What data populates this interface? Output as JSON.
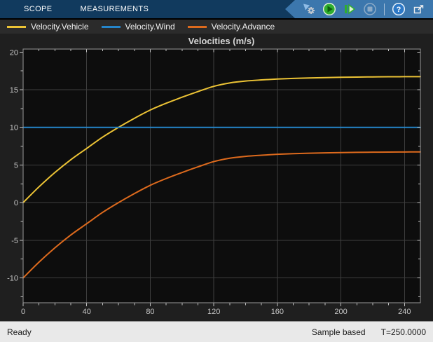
{
  "toolbar": {
    "tabs": [
      {
        "label": "SCOPE"
      },
      {
        "label": "MEASUREMENTS"
      }
    ],
    "icons": [
      "simulation-settings",
      "run",
      "step-forward",
      "stop",
      "help",
      "dock-window"
    ]
  },
  "chart_data": {
    "type": "line",
    "title": "Velocities (m/s)",
    "x": [
      0,
      10,
      20,
      30,
      40,
      50,
      60,
      70,
      80,
      90,
      100,
      110,
      120,
      130,
      140,
      150,
      160,
      170,
      180,
      190,
      200,
      210,
      220,
      230,
      240,
      250
    ],
    "series": [
      {
        "name": "Velocity.Vehicle",
        "color": "#ECC335",
        "values": [
          0.0,
          2.1,
          4.0,
          5.7,
          7.2,
          8.7,
          10.0,
          11.2,
          12.3,
          13.2,
          14.0,
          14.75,
          15.45,
          15.9,
          16.15,
          16.3,
          16.42,
          16.5,
          16.56,
          16.61,
          16.65,
          16.68,
          16.7,
          16.72,
          16.73,
          16.74
        ]
      },
      {
        "name": "Velocity.Wind",
        "color": "#2585CA",
        "values": [
          10,
          10,
          10,
          10,
          10,
          10,
          10,
          10,
          10,
          10,
          10,
          10,
          10,
          10,
          10,
          10,
          10,
          10,
          10,
          10,
          10,
          10,
          10,
          10,
          10,
          10
        ]
      },
      {
        "name": "Velocity.Advance",
        "color": "#DD6A1D",
        "values": [
          -10.0,
          -7.9,
          -6.0,
          -4.3,
          -2.8,
          -1.3,
          0.0,
          1.2,
          2.3,
          3.2,
          4.0,
          4.75,
          5.45,
          5.9,
          6.15,
          6.3,
          6.42,
          6.5,
          6.56,
          6.61,
          6.65,
          6.68,
          6.7,
          6.72,
          6.73,
          6.74
        ]
      }
    ],
    "xlim": [
      0,
      250
    ],
    "ylim": [
      -13.3,
      20.4
    ],
    "xticks": [
      0,
      40,
      80,
      120,
      160,
      200,
      240
    ],
    "yticks": [
      -10,
      -5,
      0,
      5,
      10,
      15,
      20
    ],
    "x_minor_step": 10,
    "y_minor_step": 2.5,
    "grid": true,
    "legend_position": "top"
  },
  "statusbar": {
    "status": "Ready",
    "mode": "Sample based",
    "time": "T=250.0000"
  },
  "colors": {
    "toolbar_bg": "#113A5E",
    "toolbar_panel_bg": "#3C77AD",
    "legend_bg": "#2B2B2B",
    "figure_bg": "#1F1F1F",
    "axes_bg": "#0D0D0D",
    "grid": "#3E3E3E",
    "axis_box": "#9A9A9A",
    "tick": "#C0C0C0",
    "tick_label": "#C8C8C8",
    "title": "#D6D6D6",
    "status_bg": "#E9E9E9"
  }
}
